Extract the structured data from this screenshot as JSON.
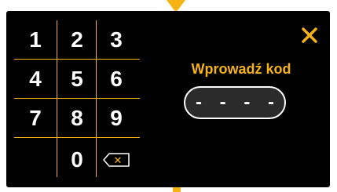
{
  "dialog": {
    "title": "Wprowadź kod",
    "code_display": "- - - -",
    "close_icon": "close-icon",
    "accent_color": "#f6b316"
  },
  "keypad": {
    "keys": [
      "1",
      "2",
      "3",
      "4",
      "5",
      "6",
      "7",
      "8",
      "9",
      "0"
    ],
    "backspace_icon": "backspace-icon"
  }
}
